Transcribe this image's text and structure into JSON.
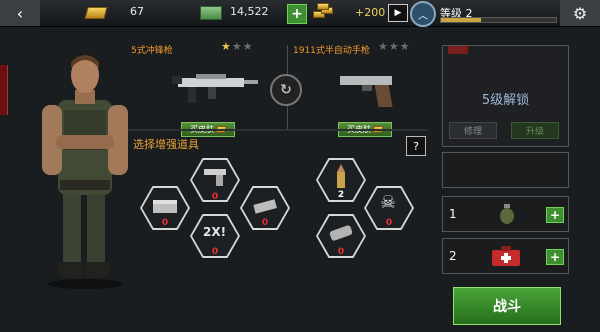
{
  "header": {
    "back_icon": "back-arrow-icon",
    "gold": "67",
    "cash": "14,522",
    "add_label": "+",
    "bonus": "+200",
    "level_label": "等级 2",
    "level_progress": 0.35,
    "settings_icon": "gear-icon"
  },
  "weapons": {
    "primary": {
      "name": "5式冲锋枪",
      "stars_filled": 1,
      "stars_total": 3,
      "skin_label": "买皮肤"
    },
    "secondary": {
      "name": "1911式半自动手枪",
      "stars_filled": 0,
      "stars_total": 3,
      "skin_label": "买皮肤"
    }
  },
  "boosts": {
    "title": "选择增强道具",
    "help_label": "?",
    "items": [
      {
        "name": "pistol",
        "count": "0"
      },
      {
        "name": "ammo-crate",
        "count": "0"
      },
      {
        "name": "rifle-ammo",
        "count": "0"
      },
      {
        "name": "double-xp",
        "count": "0"
      },
      {
        "name": "bullet",
        "count": "2"
      },
      {
        "name": "skull",
        "count": "0"
      },
      {
        "name": "minigun",
        "count": "0"
      }
    ]
  },
  "right_panel": {
    "lock_text": "5级解锁",
    "repair_label": "修理",
    "upgrade_label": "升级",
    "grenade_count": "1",
    "medkit_count": "2"
  },
  "fight_label": "战斗",
  "colors": {
    "accent_orange": "#f39a2a",
    "button_green": "#3f8f32",
    "count_red": "#e73030"
  }
}
